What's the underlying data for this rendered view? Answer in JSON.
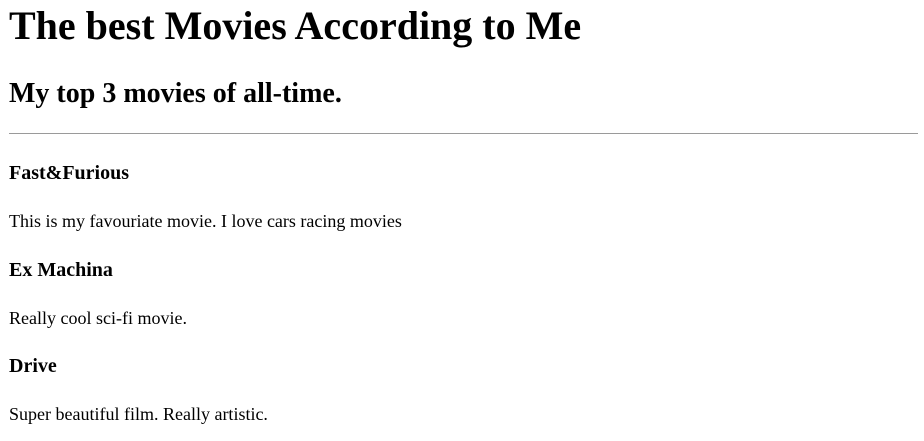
{
  "header": {
    "title": "The best Movies According to Me",
    "subtitle": "My top 3 movies of all-time."
  },
  "movies": [
    {
      "title": "Fast&Furious",
      "description": "This is my favouriate movie. I love cars racing movies"
    },
    {
      "title": "Ex Machina",
      "description": "Really cool sci-fi movie."
    },
    {
      "title": "Drive",
      "description": "Super beautiful film. Really artistic."
    }
  ]
}
